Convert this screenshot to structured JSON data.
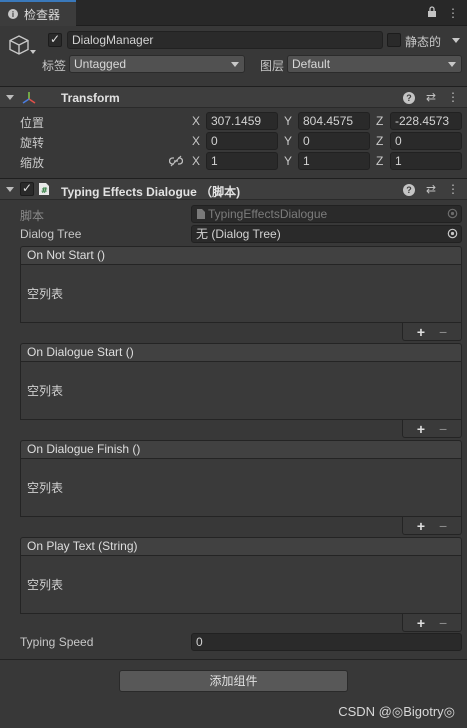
{
  "tab": {
    "label": "检查器"
  },
  "gameobject": {
    "name": "DialogManager",
    "static_label": "静态的",
    "tag_label": "标签",
    "tag_value": "Untagged",
    "layer_label": "图层",
    "layer_value": "Default"
  },
  "transform": {
    "title": "Transform",
    "position_label": "位置",
    "rotation_label": "旋转",
    "scale_label": "缩放",
    "axis_x": "X",
    "axis_y": "Y",
    "axis_z": "Z",
    "position": {
      "x": "307.1459",
      "y": "804.4575",
      "z": "-228.4573"
    },
    "rotation": {
      "x": "0",
      "y": "0",
      "z": "0"
    },
    "scale": {
      "x": "1",
      "y": "1",
      "z": "1"
    }
  },
  "script_component": {
    "title": "Typing Effects Dialogue （脚本)",
    "script_label": "脚本",
    "script_value": "TypingEffectsDialogue",
    "dialog_tree_label": "Dialog Tree",
    "dialog_tree_value": "无 (Dialog Tree)",
    "events": [
      {
        "name": "On Not Start ()",
        "empty": "空列表"
      },
      {
        "name": "On Dialogue Start ()",
        "empty": "空列表"
      },
      {
        "name": "On Dialogue Finish ()",
        "empty": "空列表"
      },
      {
        "name": "On Play Text (String)",
        "empty": "空列表"
      }
    ],
    "typing_speed_label": "Typing Speed",
    "typing_speed_value": "0"
  },
  "add_component_label": "添加组件",
  "watermark": "CSDN @◎Bigotry◎",
  "icons": {
    "plus": "+",
    "minus": "−",
    "lock": "🔒",
    "menu": "⋮"
  }
}
